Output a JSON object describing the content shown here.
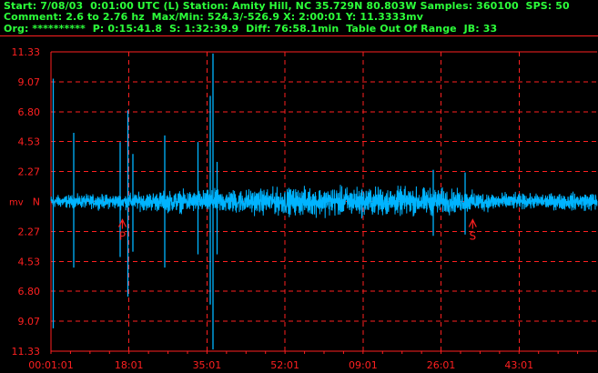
{
  "header": {
    "line1": "Start: 7/08/03  0:01:00 UTC (L) Station: Amity Hill, NC 35.729N 80.803W Samples: 360100  SPS: 50",
    "line2": "Comment: 2.6 to 2.76 hz  Max/Min: 524.3/-526.9 X: 2:00:01 Y: 11.3333mv",
    "line3": "Org: **********  P: 0:15:41.8  S: 1:32:39.9  Diff: 76:58.1min  Table Out Of Range  JB: 33"
  },
  "colors": {
    "background": "#000000",
    "grid": "#ff2020",
    "trace": "#00b4ff",
    "axis_text": "#ff2020",
    "header_text": "#2cff3a"
  },
  "chart_data": {
    "type": "line",
    "ylabel": "mv",
    "center_label": "N",
    "y_ticks": [
      "11.33",
      "9.07",
      "6.80",
      "4.53",
      "2.27",
      "",
      "2.27",
      "4.53",
      "6.80",
      "9.07",
      "11.33"
    ],
    "x_ticks": [
      "00:01:01",
      "18:01",
      "35:01",
      "52:01",
      "09:01",
      "26:01",
      "43:01"
    ],
    "ylim": [
      -11.33,
      11.33
    ],
    "xlim_minutes": [
      0,
      120
    ],
    "grid": true,
    "phase_markers": [
      {
        "label": "P",
        "time": "0:15:41.8"
      },
      {
        "label": "S",
        "time": "1:32:39.9"
      }
    ],
    "noise_envelope_mv": [
      {
        "minutes": 0,
        "amp": 0.6
      },
      {
        "minutes": 15,
        "amp": 0.7
      },
      {
        "minutes": 25,
        "amp": 1.0
      },
      {
        "minutes": 45,
        "amp": 1.2
      },
      {
        "minutes": 65,
        "amp": 1.4
      },
      {
        "minutes": 85,
        "amp": 1.3
      },
      {
        "minutes": 92,
        "amp": 1.0
      },
      {
        "minutes": 105,
        "amp": 0.7
      },
      {
        "minutes": 120,
        "amp": 0.9
      }
    ],
    "spikes_mv": [
      {
        "minutes": 0.5,
        "max": 9.3,
        "min": -9.6
      },
      {
        "minutes": 5.0,
        "max": 5.2,
        "min": -5.0
      },
      {
        "minutes": 15.2,
        "max": 4.5,
        "min": -4.2
      },
      {
        "minutes": 16.9,
        "max": 6.9,
        "min": -7.2
      },
      {
        "minutes": 18.0,
        "max": 3.6,
        "min": -3.8
      },
      {
        "minutes": 25.0,
        "max": 5.0,
        "min": -5.0
      },
      {
        "minutes": 32.3,
        "max": 4.5,
        "min": -4.0
      },
      {
        "minutes": 35.0,
        "max": 8.0,
        "min": -7.8
      },
      {
        "minutes": 35.6,
        "max": 11.2,
        "min": -11.2
      },
      {
        "minutes": 36.5,
        "max": 3.0,
        "min": -4.0
      },
      {
        "minutes": 84.0,
        "max": 2.4,
        "min": -2.6
      },
      {
        "minutes": 91.0,
        "max": 2.2,
        "min": -2.5
      }
    ]
  }
}
